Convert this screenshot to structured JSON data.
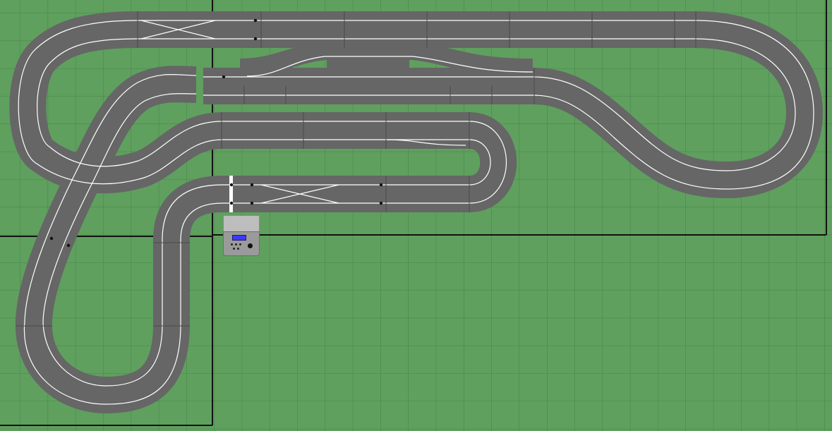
{
  "colors": {
    "grass": "#5fa05f",
    "grid_line": "#3c7a3c",
    "track": "#666666",
    "track_joint": "#4a4a4a",
    "lane_line": "#ffffff",
    "table_edge": "#111111"
  },
  "layout": {
    "lanes": 2,
    "lap_counter": "control-unit-icon"
  }
}
